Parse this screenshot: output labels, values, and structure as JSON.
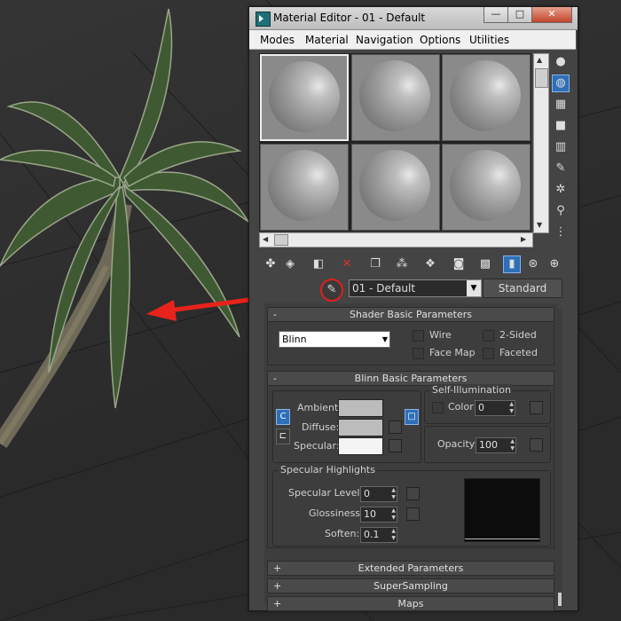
{
  "window": {
    "title": "Material Editor - 01 - Default",
    "minimize": "—",
    "maximize": "□",
    "close": "✕"
  },
  "menu": [
    "Modes",
    "Material",
    "Navigation",
    "Options",
    "Utilities"
  ],
  "sample_slots": {
    "count": 6,
    "selected_index": 0
  },
  "side_tools": [
    "sample-type-icon",
    "backlight-icon",
    "background-checker-icon",
    "uv-tiling-icon",
    "video-color-check-icon",
    "make-preview-icon",
    "options-icon",
    "select-by-material-icon",
    "material-map-navigator-icon"
  ],
  "toolbar_tools": [
    "get-material-icon",
    "put-to-scene-icon",
    "assign-to-selection-icon",
    "reset-map-icon",
    "make-copy-icon",
    "make-unique-icon",
    "put-to-library-icon",
    "material-id-channel-icon",
    "show-shaded-in-viewport-icon",
    "show-end-result-icon",
    "go-to-parent-icon",
    "go-forward-to-sibling-icon"
  ],
  "material": {
    "picker_glyph": "✎",
    "name": "01 - Default",
    "type_button": "Standard"
  },
  "shader_basic": {
    "header": "Shader Basic Parameters",
    "sign": "-",
    "shader": "Blinn",
    "wire": "Wire",
    "two_sided": "2-Sided",
    "face_map": "Face Map",
    "faceted": "Faceted"
  },
  "blinn_basic": {
    "header": "Blinn Basic Parameters",
    "sign": "-",
    "ambient": "Ambient:",
    "diffuse": "Diffuse:",
    "specular": "Specular:",
    "lock_a": "C",
    "lock_b": "□",
    "self_illum_title": "Self-Illumination",
    "color_label": "Color",
    "self_illum_value": "0",
    "opacity_label": "Opacity:",
    "opacity_value": "100",
    "ambient_color": "#bcbcbc",
    "diffuse_color": "#bcbcbc",
    "specular_color": "#f4f4f4"
  },
  "specular_highlights": {
    "title": "Specular Highlights",
    "level_label": "Specular Level:",
    "level_value": "0",
    "gloss_label": "Glossiness:",
    "gloss_value": "10",
    "soften_label": "Soften:",
    "soften_value": "0.1"
  },
  "collapsed_rollouts": [
    {
      "sign": "+",
      "label": "Extended Parameters"
    },
    {
      "sign": "+",
      "label": "SuperSampling"
    },
    {
      "sign": "+",
      "label": "Maps"
    }
  ]
}
